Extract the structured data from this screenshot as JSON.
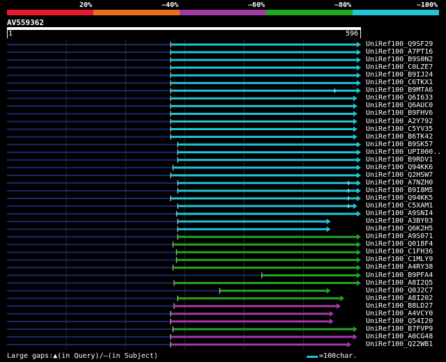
{
  "legend": {
    "segments": [
      {
        "label": "20%",
        "color": "#e8182e"
      },
      {
        "label": "~40%",
        "color": "#e8701e"
      },
      {
        "label": "~60%",
        "color": "#a43aa4"
      },
      {
        "label": "~80%",
        "color": "#23a51f"
      },
      {
        "label": "~100%",
        "color": "#22c4d6"
      }
    ]
  },
  "query": {
    "name": "AV559362",
    "start": "1",
    "end": "596",
    "length": 596
  },
  "colors": {
    "line": "#1a2a6e",
    "grid": "#2a2a2a",
    "tick": "#ffffff"
  },
  "hits": [
    {
      "label": "UniRef100_Q9SF29",
      "start": 276,
      "end": 596,
      "color": "#22c4d6",
      "tick": null
    },
    {
      "label": "UniRef100_A7PT16",
      "start": 276,
      "end": 596,
      "color": "#22c4d6",
      "tick": null
    },
    {
      "label": "UniRef100_B9S0N2",
      "start": 276,
      "end": 596,
      "color": "#22c4d6",
      "tick": null
    },
    {
      "label": "UniRef100_C0LZE7",
      "start": 276,
      "end": 596,
      "color": "#22c4d6",
      "tick": null
    },
    {
      "label": "UniRef100_B9IJ24",
      "start": 276,
      "end": 596,
      "color": "#22c4d6",
      "tick": null
    },
    {
      "label": "UniRef100_C6TKX1",
      "start": 276,
      "end": 596,
      "color": "#22c4d6",
      "tick": null
    },
    {
      "label": "UniRef100_B9MTA6",
      "start": 276,
      "end": 596,
      "color": "#22c4d6",
      "tick": 553
    },
    {
      "label": "UniRef100_Q6I633",
      "start": 276,
      "end": 590,
      "color": "#22c4d6",
      "tick": null
    },
    {
      "label": "UniRef100_Q6AUC0",
      "start": 276,
      "end": 590,
      "color": "#22c4d6",
      "tick": null
    },
    {
      "label": "UniRef100_B9FHV6",
      "start": 276,
      "end": 590,
      "color": "#22c4d6",
      "tick": null
    },
    {
      "label": "UniRef100_A2Y792",
      "start": 276,
      "end": 590,
      "color": "#22c4d6",
      "tick": null
    },
    {
      "label": "UniRef100_C5YV35",
      "start": 276,
      "end": 590,
      "color": "#22c4d6",
      "tick": null
    },
    {
      "label": "UniRef100_B6TK42",
      "start": 276,
      "end": 590,
      "color": "#22c4d6",
      "tick": null
    },
    {
      "label": "UniRef100_B9SK57",
      "start": 288,
      "end": 596,
      "color": "#22c4d6",
      "tick": null
    },
    {
      "label": "UniRef100_UPI000..",
      "start": 288,
      "end": 596,
      "color": "#22c4d6",
      "tick": null
    },
    {
      "label": "UniRef100_B9RDV1",
      "start": 288,
      "end": 596,
      "color": "#22c4d6",
      "tick": null
    },
    {
      "label": "UniRef100_Q94KK6",
      "start": 280,
      "end": 596,
      "color": "#22c4d6",
      "tick": null
    },
    {
      "label": "UniRef100_Q2HSW7",
      "start": 276,
      "end": 596,
      "color": "#22c4d6",
      "tick": null
    },
    {
      "label": "UniRef100_A7NZH0",
      "start": 288,
      "end": 596,
      "color": "#22c4d6",
      "tick": 576
    },
    {
      "label": "UniRef100_B9I8M5",
      "start": 288,
      "end": 596,
      "color": "#22c4d6",
      "tick": 576
    },
    {
      "label": "UniRef100_Q94KK5",
      "start": 276,
      "end": 596,
      "color": "#22c4d6",
      "tick": 576
    },
    {
      "label": "UniRef100_C5XAM1",
      "start": 288,
      "end": 590,
      "color": "#22c4d6",
      "tick": 576
    },
    {
      "label": "UniRef100_A9SNI4",
      "start": 286,
      "end": 596,
      "color": "#22c4d6",
      "tick": null
    },
    {
      "label": "UniRef100_A3BY03",
      "start": 288,
      "end": 545,
      "color": "#22c4d6",
      "tick": null
    },
    {
      "label": "UniRef100_Q6K2H5",
      "start": 288,
      "end": 545,
      "color": "#22c4d6",
      "tick": null
    },
    {
      "label": "UniRef100_A9S071",
      "start": 288,
      "end": 596,
      "color": "#23a51f",
      "tick": null
    },
    {
      "label": "UniRef100_Q018F4",
      "start": 280,
      "end": 596,
      "color": "#23a51f",
      "tick": null
    },
    {
      "label": "UniRef100_C1FH36",
      "start": 286,
      "end": 596,
      "color": "#23a51f",
      "tick": null
    },
    {
      "label": "UniRef100_C1MLY9",
      "start": 286,
      "end": 596,
      "color": "#23a51f",
      "tick": null
    },
    {
      "label": "UniRef100_A4RY38",
      "start": 280,
      "end": 596,
      "color": "#23a51f",
      "tick": null
    },
    {
      "label": "UniRef100_B9PFA4",
      "start": 430,
      "end": 596,
      "color": "#23a51f",
      "tick": null
    },
    {
      "label": "UniRef100_A8I2Q5",
      "start": 282,
      "end": 596,
      "color": "#23a51f",
      "tick": null
    },
    {
      "label": "UniRef100_Q0J2C7",
      "start": 359,
      "end": 545,
      "color": "#23a51f",
      "tick": null
    },
    {
      "label": "UniRef100_A8I202",
      "start": 288,
      "end": 568,
      "color": "#23a51f",
      "tick": null
    },
    {
      "label": "UniRef100_B8LD27",
      "start": 282,
      "end": 562,
      "color": "#a43aa4",
      "tick": null
    },
    {
      "label": "UniRef100_A4VCY0",
      "start": 276,
      "end": 550,
      "color": "#a43aa4",
      "tick": null
    },
    {
      "label": "UniRef100_Q54I20",
      "start": 276,
      "end": 550,
      "color": "#a43aa4",
      "tick": null
    },
    {
      "label": "UniRef100_B7FVP9",
      "start": 280,
      "end": 590,
      "color": "#23a51f",
      "tick": null
    },
    {
      "label": "UniRef100_A0CG48",
      "start": 276,
      "end": 590,
      "color": "#a43aa4",
      "tick": null
    },
    {
      "label": "UniRef100_Q22WB1",
      "start": 276,
      "end": 580,
      "color": "#a43aa4",
      "tick": null
    }
  ],
  "footer": {
    "gaps_text": "Large gaps:▲(in Query)/—(in Subject)",
    "scale_text": "=100char."
  }
}
